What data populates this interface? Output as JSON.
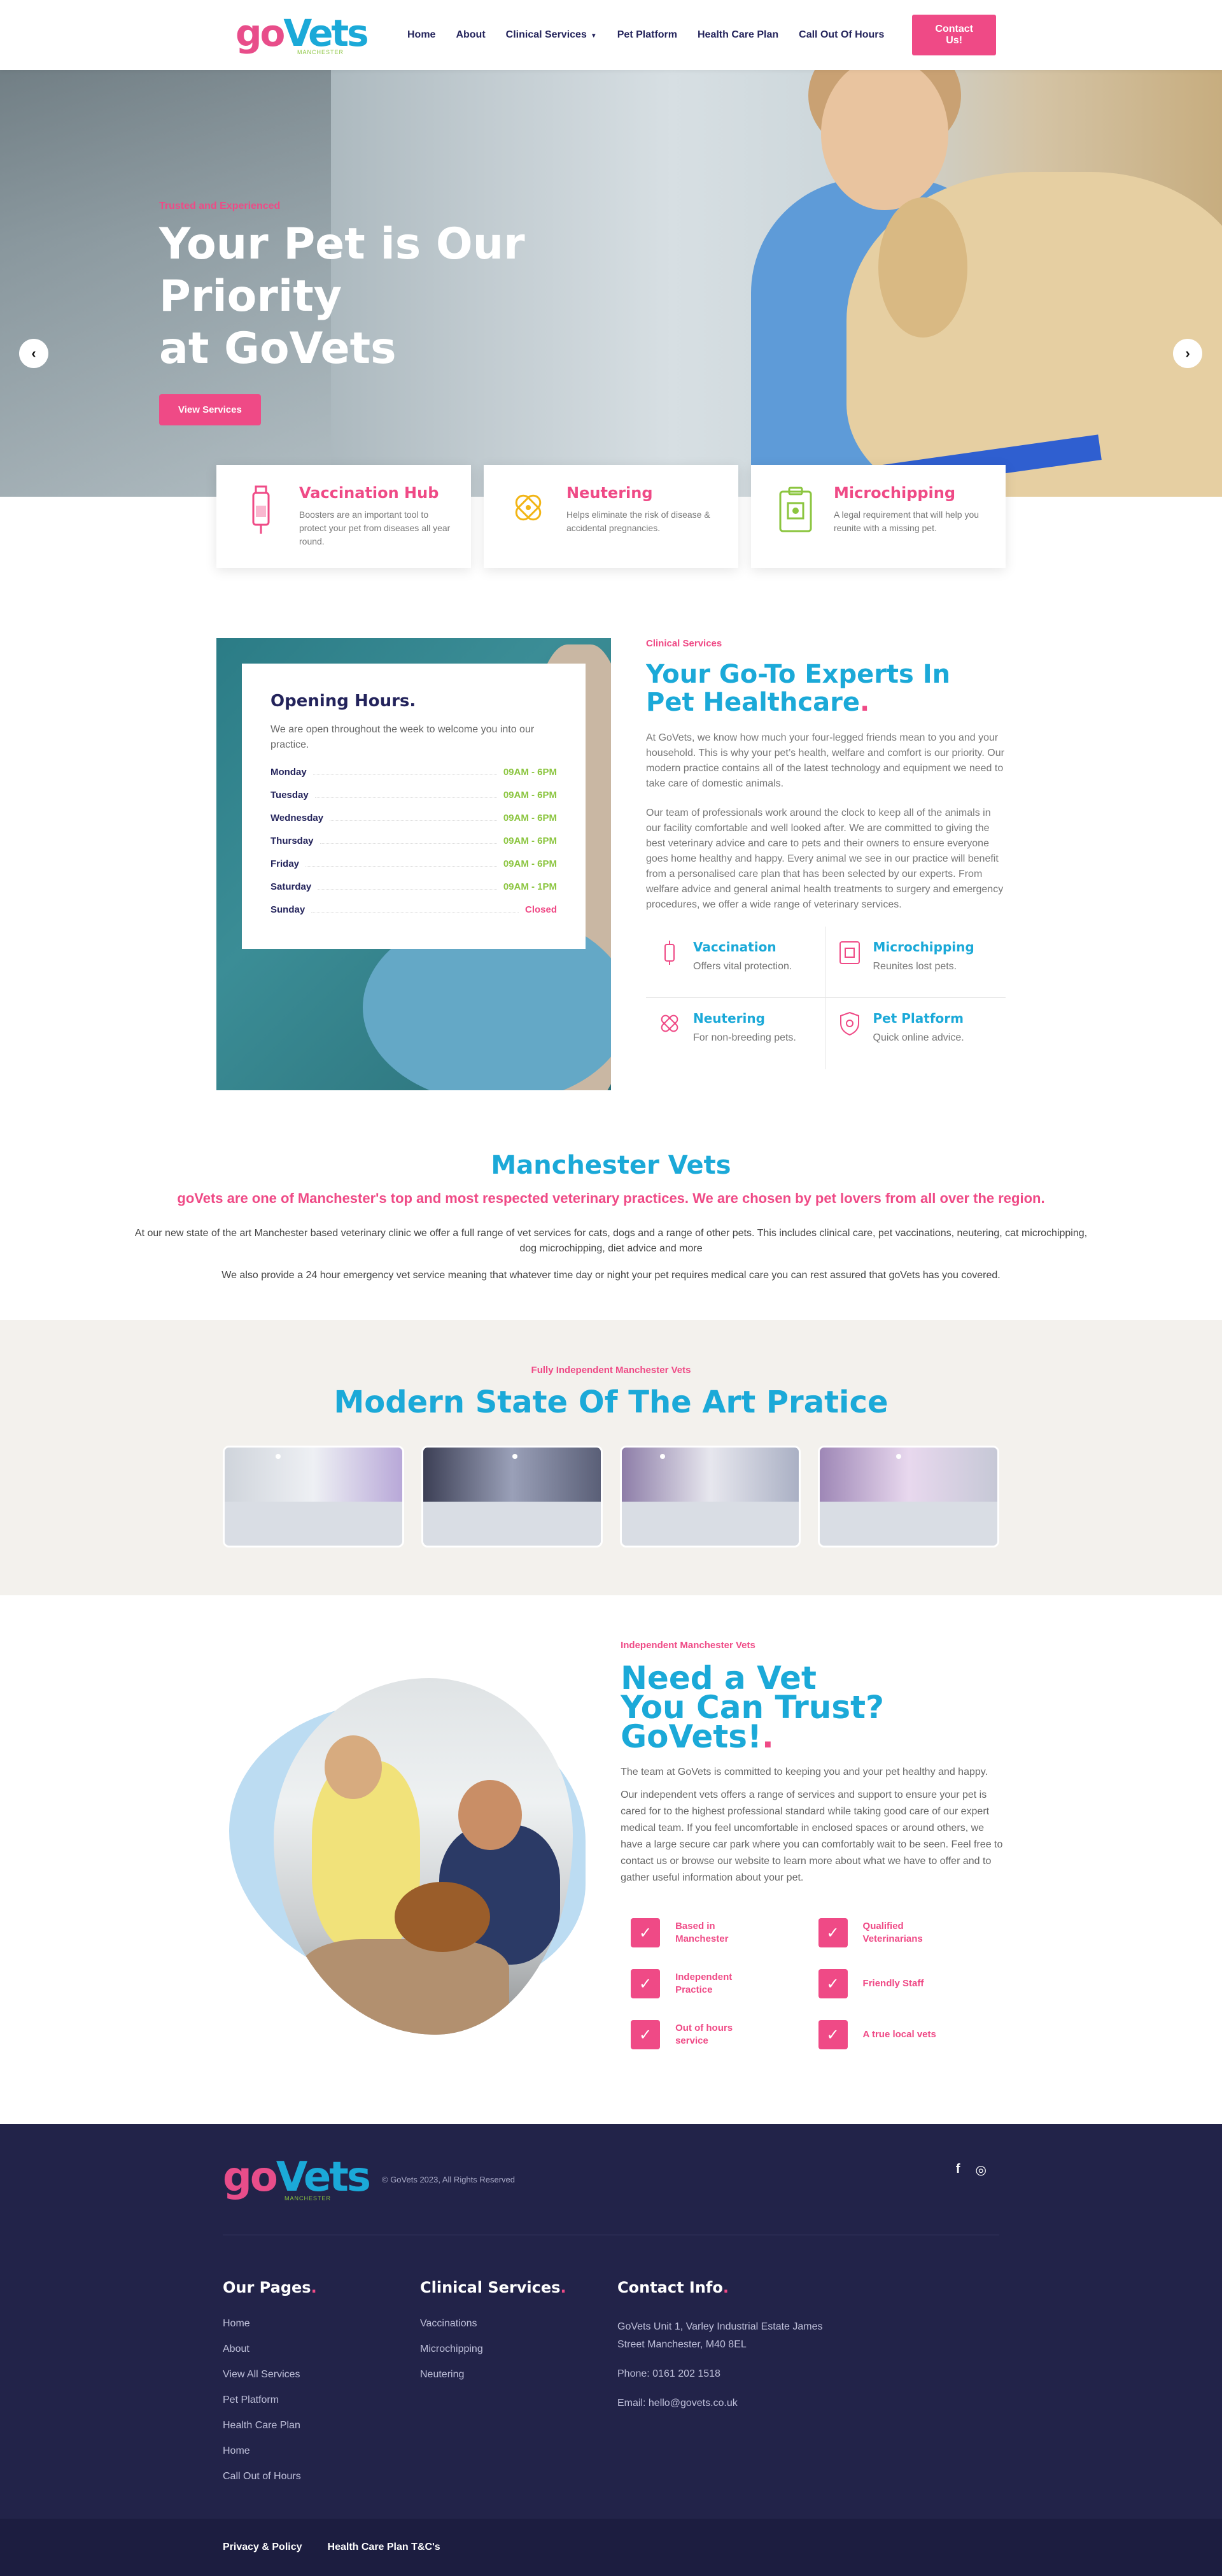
{
  "header": {
    "logo_go": "go",
    "logo_vets": "Vets",
    "logo_sub": "MANCHESTER",
    "nav": [
      "Home",
      "About",
      "Clinical Services",
      "Pet Platform",
      "Health Care Plan",
      "Call Out Of Hours"
    ],
    "cta": "Contact Us!"
  },
  "hero": {
    "kicker": "Trusted and Experienced",
    "title_line1": "Your Pet is Our Priority",
    "title_line2": "at GoVets",
    "button": "View Services",
    "prev": "‹",
    "next": "›"
  },
  "cards": [
    {
      "title": "Vaccination Hub",
      "text": "Boosters are an important tool to protect your pet from diseases all year round.",
      "icon": "syringe-icon"
    },
    {
      "title": "Neutering",
      "text": "Helps eliminate the risk of disease & accidental pregnancies.",
      "icon": "paw-bandage-icon"
    },
    {
      "title": "Microchipping",
      "text": "A legal requirement that will help you reunite with a missing pet.",
      "icon": "chip-clipboard-icon"
    }
  ],
  "hours": {
    "title": "Opening Hours.",
    "intro": "We are open throughout the week to welcome you into our practice.",
    "rows": [
      {
        "day": "Monday",
        "time": "09AM - 6PM"
      },
      {
        "day": "Tuesday",
        "time": "09AM - 6PM"
      },
      {
        "day": "Wednesday",
        "time": "09AM - 6PM"
      },
      {
        "day": "Thursday",
        "time": "09AM - 6PM"
      },
      {
        "day": "Friday",
        "time": "09AM - 6PM"
      },
      {
        "day": "Saturday",
        "time": "09AM - 1PM"
      },
      {
        "day": "Sunday",
        "time": "Closed"
      }
    ]
  },
  "about": {
    "kicker": "Clinical Services",
    "title": "Your Go-To Experts In Pet Healthcare",
    "p1": "At GoVets, we know how much your four-legged friends mean to you and your household. This is why your pet’s health, welfare and comfort is our priority. Our modern practice contains all of the latest technology and equipment we need to take care of domestic animals.",
    "p2": "Our team of professionals work around the clock to keep all of the animals in our facility comfortable and well looked after. We are committed to giving the best veterinary advice and care to pets and their owners to ensure everyone goes home healthy and happy. Every animal we see in our practice will benefit from a personalised care plan that has been selected by our experts. From welfare advice and general animal health treatments to surgery and emergency procedures, we offer a wide range of veterinary services.",
    "features": [
      {
        "title": "Vaccination",
        "desc": "Offers vital protection.",
        "icon": "vaccine-icon"
      },
      {
        "title": "Microchipping",
        "desc": "Reunites lost pets.",
        "icon": "chip-icon"
      },
      {
        "title": "Neutering",
        "desc": "For non-breeding pets.",
        "icon": "paw-icon"
      },
      {
        "title": "Pet Platform",
        "desc": "Quick online advice.",
        "icon": "shield-icon"
      }
    ]
  },
  "manchester": {
    "title": "Manchester Vets",
    "subtitle": "goVets are one of Manchester's top and most respected veterinary practices. We are chosen by pet lovers from all over the region.",
    "p1": "At our new state of the art Manchester based veterinary clinic we offer a full range of vet services for cats, dogs and a range of other pets. This includes clinical care, pet vaccinations, neutering, cat microchipping, dog microchipping, diet advice and more",
    "p2": "We also provide a 24 hour emergency vet service meaning that whatever time day or night your pet requires medical care you can rest assured that goVets has you covered."
  },
  "gallery": {
    "kicker": "Fully Independent Manchester Vets",
    "title": "Modern State Of The Art Pratice"
  },
  "trust": {
    "kicker": "Independent Manchester Vets",
    "title_l1": "Need a Vet",
    "title_l2": "You Can Trust?",
    "title_l3": "GoVets!",
    "p1": "The team at GoVets is committed to keeping you and your pet healthy and happy.",
    "p2": "Our independent vets offers a range of services and support to ensure your pet is cared for to the highest professional standard while taking good care of our expert medical team. If you feel uncomfortable in enclosed spaces or around others, we have a large secure car park where you can comfortably wait to be seen. Feel free to contact us or browse our website to learn more about what we have to offer and to gather useful information about your pet.",
    "checks": [
      "Based in Manchester",
      "Qualified Veterinarians",
      "Independent Practice",
      "Friendly Staff",
      "Out of hours service",
      "A true local vets"
    ]
  },
  "footer": {
    "copyright": "© GoVets 2023, All Rights Reserved",
    "social": [
      "f",
      "◎"
    ],
    "pages_title": "Our Pages",
    "pages": [
      "Home",
      "About",
      "View All Services",
      "Pet Platform",
      "Health Care Plan",
      "Home",
      "Call Out of Hours"
    ],
    "services_title": "Clinical Services",
    "services": [
      "Vaccinations",
      "Microchipping",
      "Neutering"
    ],
    "contact_title": "Contact Info",
    "address": "GoVets Unit 1, Varley Industrial Estate James Street Manchester, M40 8EL",
    "phone": "Phone: 0161 202 1518",
    "email": "Email: hello@govets.co.uk",
    "bottom_links": [
      "Privacy & Policy",
      "Health Care Plan T&C's"
    ]
  }
}
